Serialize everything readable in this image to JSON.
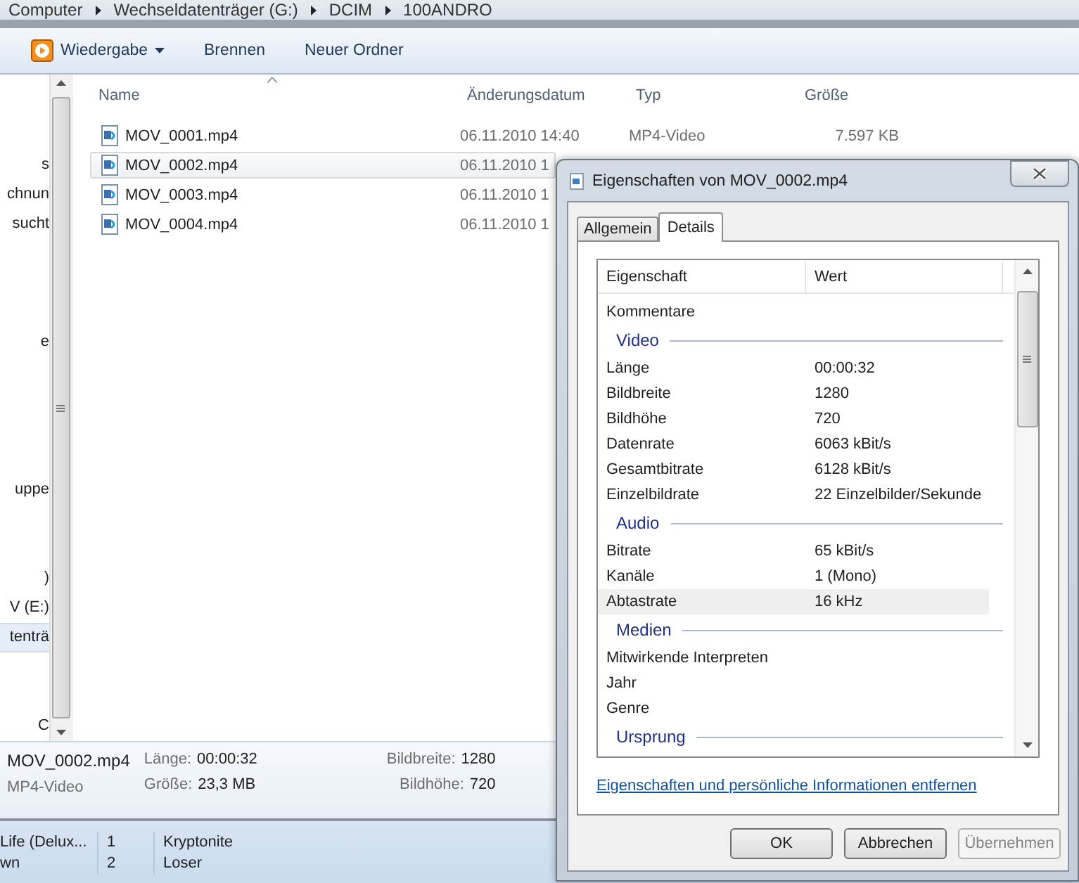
{
  "breadcrumb": [
    "Computer",
    "Wechseldatenträger (G:)",
    "DCIM",
    "100ANDRO"
  ],
  "toolbar": [
    {
      "label": "Wiedergabe",
      "kind": "menu"
    },
    {
      "label": "Brennen",
      "kind": "plain"
    },
    {
      "label": "Neuer Ordner",
      "kind": "plain"
    }
  ],
  "nav_pane": {
    "items": [
      {
        "label": "s",
        "selected": false
      },
      {
        "label": "chnun",
        "selected": false
      },
      {
        "label": "sucht",
        "selected": false
      },
      {
        "label": "e",
        "selected": false
      },
      {
        "label": "uppe",
        "selected": false
      },
      {
        "label": ")",
        "selected": false
      },
      {
        "label": "V (E:)",
        "selected": false
      },
      {
        "label": "tenträ",
        "selected": true
      },
      {
        "label": "C",
        "selected": false
      }
    ]
  },
  "file_list": {
    "columns": [
      "Name",
      "Änderungsdatum",
      "Typ",
      "Größe"
    ],
    "rows": [
      {
        "name": "MOV_0001.mp4",
        "date": "06.11.2010 14:40",
        "type": "MP4-Video",
        "size": "7.597 KB",
        "selected": false
      },
      {
        "name": "MOV_0002.mp4",
        "date": "06.11.2010 1",
        "selected": true
      },
      {
        "name": "MOV_0003.mp4",
        "date": "06.11.2010 1",
        "selected": false
      },
      {
        "name": "MOV_0004.mp4",
        "date": "06.11.2010 1",
        "selected": false
      }
    ]
  },
  "details_pane": {
    "file_name": "MOV_0002.mp4",
    "file_type": "MP4-Video",
    "fields": [
      {
        "label": "Länge:",
        "value": "00:00:32"
      },
      {
        "label": "Größe:",
        "value": "23,3 MB"
      },
      {
        "label": "Bildbreite:",
        "value": "1280"
      },
      {
        "label": "Bildhöhe:",
        "value": "720"
      }
    ]
  },
  "player_list": {
    "rows": [
      {
        "album": "Life (Delux...",
        "track": "1",
        "title": "Kryptonite"
      },
      {
        "album": "wn",
        "track": "2",
        "title": "Loser"
      }
    ]
  },
  "dialog": {
    "title": "Eigenschaften von MOV_0002.mp4",
    "tabs": [
      {
        "label": "Allgemein",
        "selected": false
      },
      {
        "label": "Details",
        "selected": true
      }
    ],
    "columns": [
      "Eigenschaft",
      "Wert"
    ],
    "items": [
      {
        "kind": "property",
        "name": "Kommentare",
        "selected": false
      },
      {
        "kind": "group",
        "label": "Video"
      },
      {
        "kind": "property",
        "name": "Länge",
        "value": "00:00:32",
        "selected": false
      },
      {
        "kind": "property",
        "name": "Bildbreite",
        "value": "1280",
        "selected": false
      },
      {
        "kind": "property",
        "name": "Bildhöhe",
        "value": "720",
        "selected": false
      },
      {
        "kind": "property",
        "name": "Datenrate",
        "value": "6063 kBit/s",
        "selected": false
      },
      {
        "kind": "property",
        "name": "Gesamtbitrate",
        "value": "6128 kBit/s",
        "selected": false
      },
      {
        "kind": "property",
        "name": "Einzelbildrate",
        "value": "22 Einzelbilder/Sekunde",
        "selected": false
      },
      {
        "kind": "group",
        "label": "Audio"
      },
      {
        "kind": "property",
        "name": "Bitrate",
        "value": "65 kBit/s",
        "selected": false
      },
      {
        "kind": "property",
        "name": "Kanäle",
        "value": "1 (Mono)",
        "selected": false
      },
      {
        "kind": "property",
        "name": "Abtastrate",
        "value": "16 kHz",
        "selected": true
      },
      {
        "kind": "group",
        "label": "Medien"
      },
      {
        "kind": "property",
        "name": "Mitwirkende Interpreten",
        "selected": false
      },
      {
        "kind": "property",
        "name": "Jahr",
        "selected": false
      },
      {
        "kind": "property",
        "name": "Genre",
        "selected": false
      },
      {
        "kind": "group",
        "label": "Ursprung"
      }
    ],
    "link": "Eigenschaften und persönliche Informationen entfernen",
    "buttons": [
      {
        "label": "OK",
        "disabled": false
      },
      {
        "label": "Abbrechen",
        "disabled": false
      },
      {
        "label": "Übernehmen",
        "disabled": true
      }
    ]
  }
}
